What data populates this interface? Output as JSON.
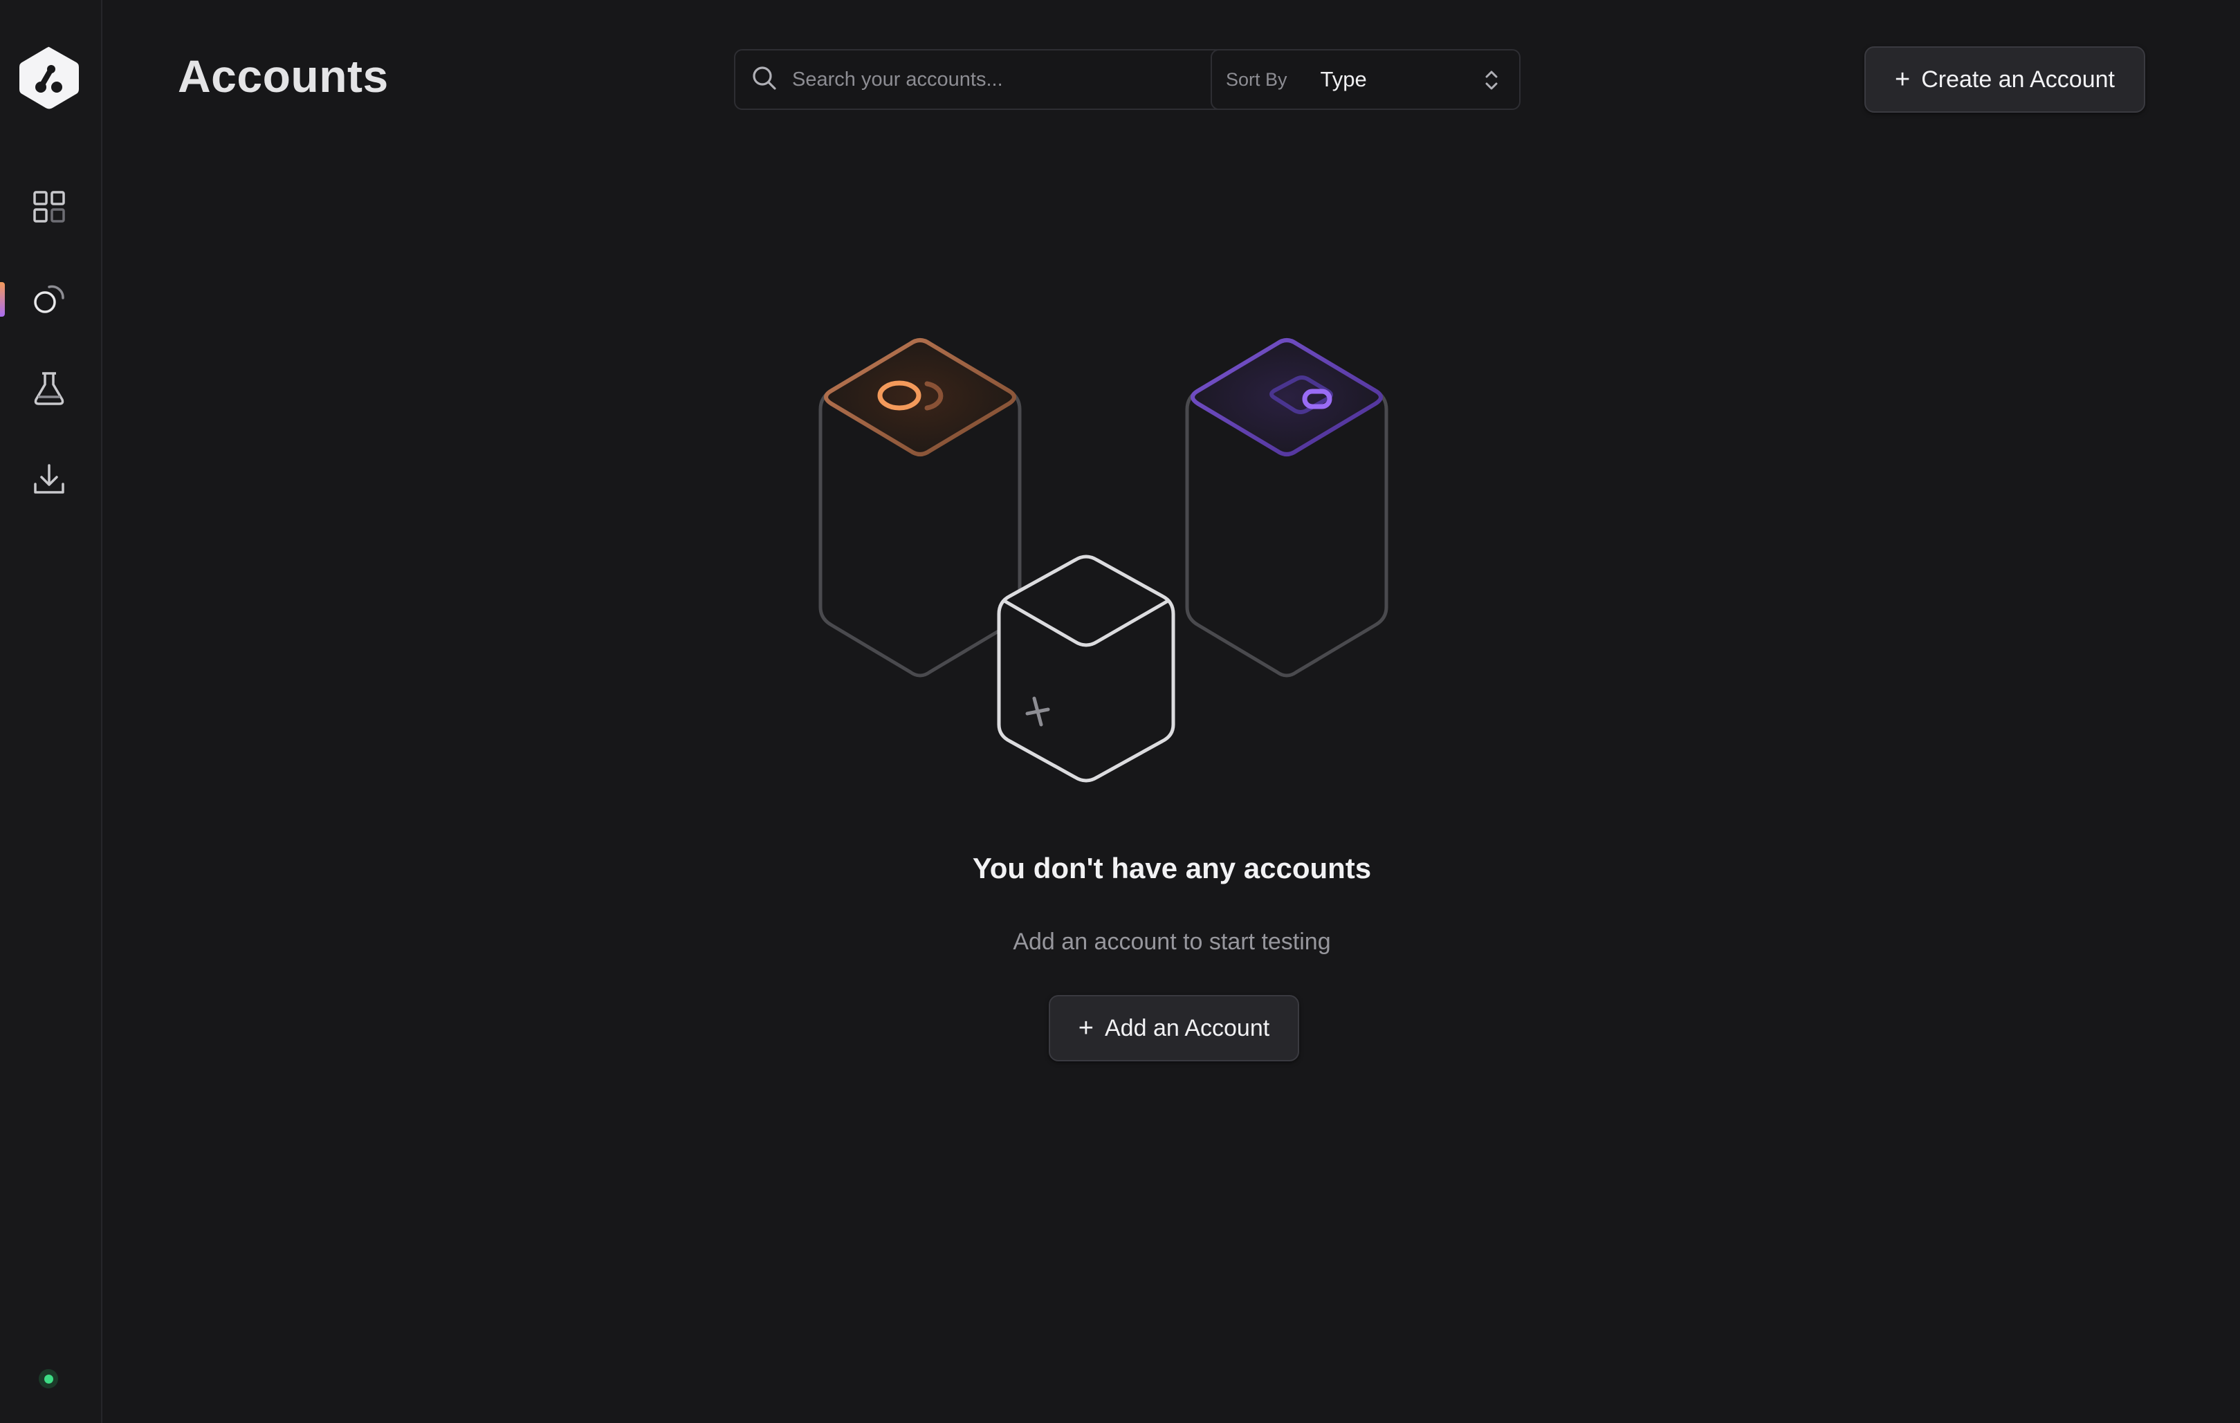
{
  "header": {
    "title": "Accounts",
    "search_placeholder": "Search your accounts...",
    "search_value": "",
    "sort_label": "Sort By",
    "sort_value": "Type",
    "create_button_label": "Create an Account"
  },
  "sidebar": {
    "items": [
      {
        "name": "dashboard",
        "icon": "grid-icon"
      },
      {
        "name": "accounts",
        "icon": "accounts-icon",
        "active": true
      },
      {
        "name": "tests",
        "icon": "flask-icon"
      },
      {
        "name": "downloads",
        "icon": "download-icon"
      }
    ],
    "status": "online"
  },
  "empty_state": {
    "title": "You don't have any accounts",
    "subtitle": "Add an account to start testing",
    "button_label": "Add an Account"
  },
  "colors": {
    "background": "#171719",
    "accent_orange": "#f39a5b",
    "accent_purple": "#8e5cf0",
    "status_green": "#3ddc84"
  }
}
